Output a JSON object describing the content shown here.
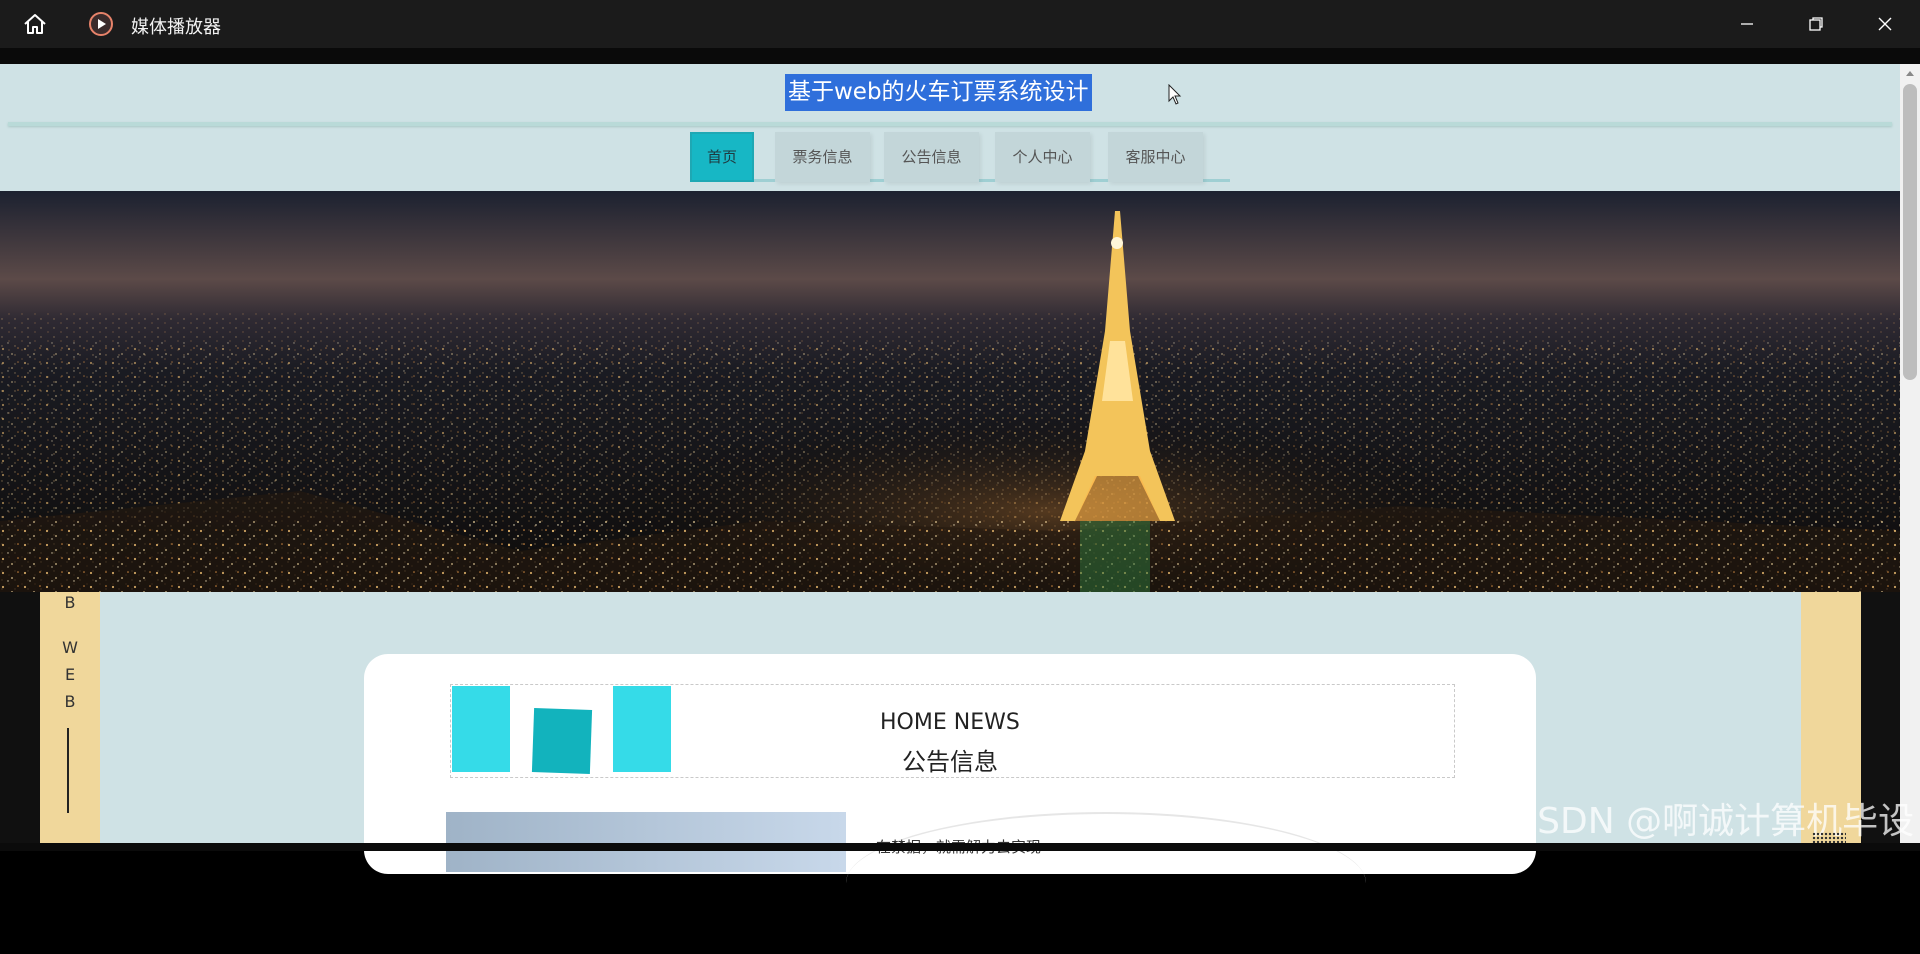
{
  "titlebar": {
    "app_title": "媒体播放器"
  },
  "header": {
    "site_title": "基于web的火车订票系统设计"
  },
  "nav": {
    "items": [
      {
        "label": "首页",
        "active": true
      },
      {
        "label": "票务信息",
        "active": false
      },
      {
        "label": "公告信息",
        "active": false
      },
      {
        "label": "个人中心",
        "active": false
      },
      {
        "label": "客服中心",
        "active": false
      }
    ]
  },
  "side_strip": {
    "letters": [
      "B",
      "W",
      "E",
      "B"
    ]
  },
  "news": {
    "en_title": "HOME NEWS",
    "cn_title": "公告信息",
    "preview_text": "在禁据，就需解力去实现"
  },
  "watermark": "CSDN @啊诚计算机毕设",
  "colors": {
    "accent": "#17b7c5",
    "page_bg": "#cfe2e5",
    "strip": "#f0d79b",
    "selection": "#2f6fdb"
  }
}
